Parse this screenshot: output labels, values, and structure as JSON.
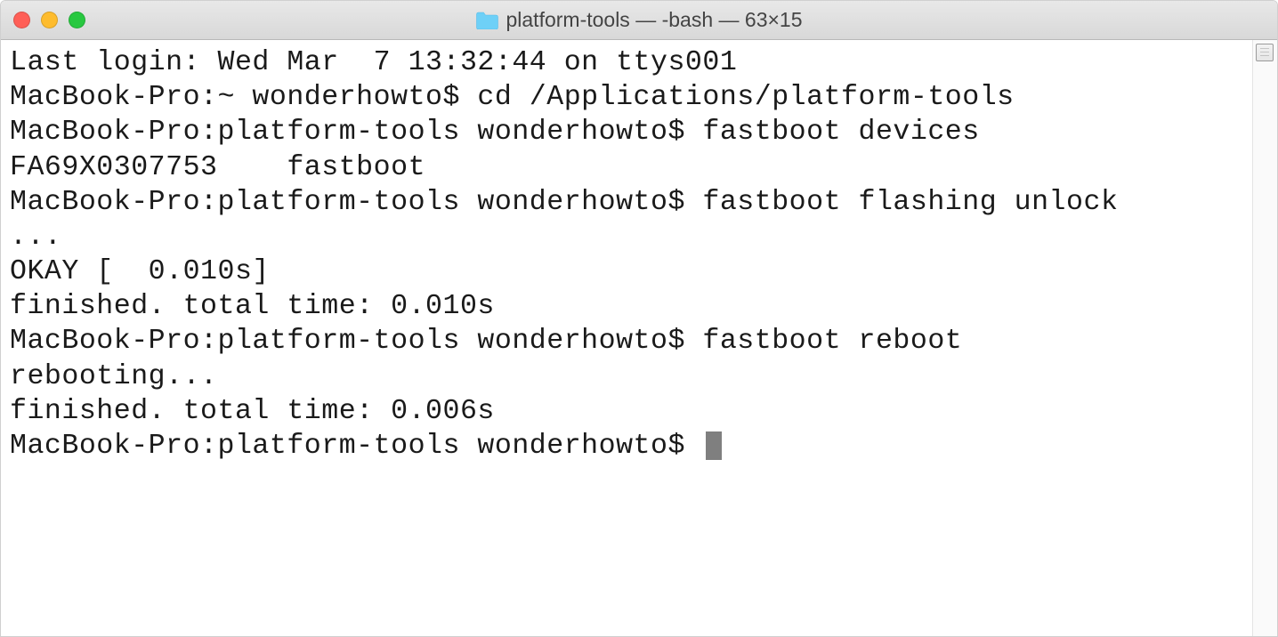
{
  "titlebar": {
    "title": "platform-tools — -bash — 63×15"
  },
  "terminal": {
    "lines": [
      "Last login: Wed Mar  7 13:32:44 on ttys001",
      "MacBook-Pro:~ wonderhowto$ cd /Applications/platform-tools",
      "MacBook-Pro:platform-tools wonderhowto$ fastboot devices",
      "FA69X0307753    fastboot",
      "MacBook-Pro:platform-tools wonderhowto$ fastboot flashing unlock",
      "...",
      "OKAY [  0.010s]",
      "finished. total time: 0.010s",
      "MacBook-Pro:platform-tools wonderhowto$ fastboot reboot",
      "rebooting...",
      "",
      "finished. total time: 0.006s"
    ],
    "prompt": "MacBook-Pro:platform-tools wonderhowto$ "
  }
}
